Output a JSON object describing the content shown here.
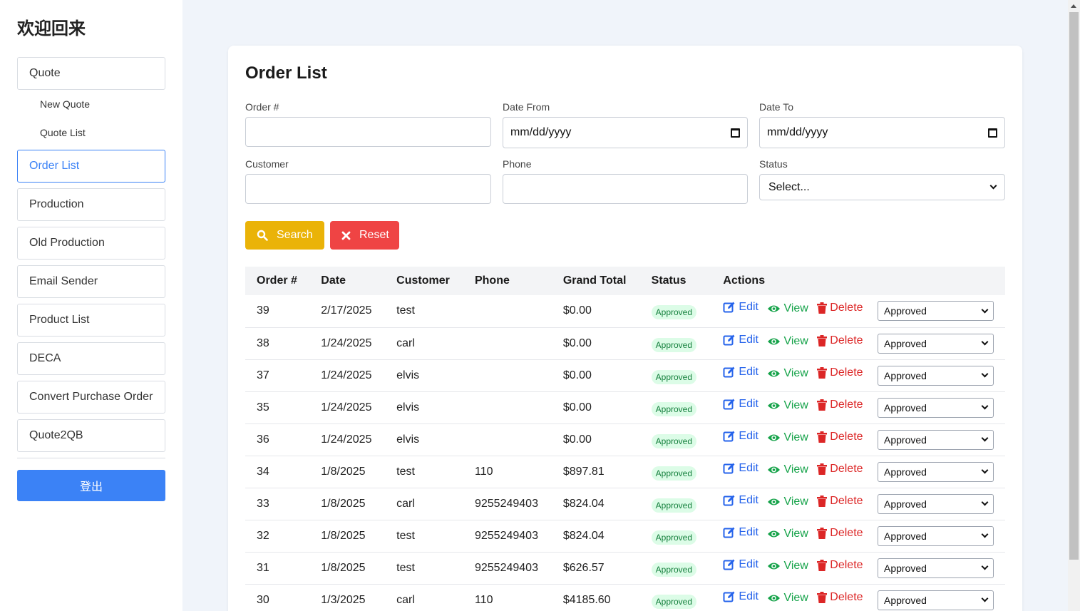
{
  "sidebar": {
    "title": "欢迎回来",
    "quote": "Quote",
    "sub_items": [
      "New Quote",
      "Quote List"
    ],
    "items": [
      "Order List",
      "Production",
      "Old Production",
      "Email Sender",
      "Product List",
      "DECA",
      "Convert Purchase Order",
      "Quote2QB"
    ],
    "active": "Order List",
    "logout": "登出"
  },
  "main": {
    "title": "Order List",
    "filters": {
      "order_label": "Order #",
      "date_from_label": "Date From",
      "date_from_value": "mm/dd/yyyy",
      "date_to_label": "Date To",
      "date_to_value": "mm/dd/yyyy",
      "customer_label": "Customer",
      "phone_label": "Phone",
      "status_label": "Status",
      "status_value": "Select..."
    },
    "search_label": "Search",
    "reset_label": "Reset"
  },
  "table": {
    "headers": [
      "Order #",
      "Date",
      "Customer",
      "Phone",
      "Grand Total",
      "Status",
      "Actions"
    ],
    "actions": {
      "edit": "Edit",
      "view": "View",
      "delete": "Delete"
    },
    "rows": [
      {
        "order": "39",
        "date": "2/17/2025",
        "customer": "test",
        "phone": "",
        "total": "$0.00",
        "status": "Approved",
        "select": "Approved"
      },
      {
        "order": "38",
        "date": "1/24/2025",
        "customer": "carl",
        "phone": "",
        "total": "$0.00",
        "status": "Approved",
        "select": "Approved"
      },
      {
        "order": "37",
        "date": "1/24/2025",
        "customer": "elvis",
        "phone": "",
        "total": "$0.00",
        "status": "Approved",
        "select": "Approved"
      },
      {
        "order": "35",
        "date": "1/24/2025",
        "customer": "elvis",
        "phone": "",
        "total": "$0.00",
        "status": "Approved",
        "select": "Approved"
      },
      {
        "order": "36",
        "date": "1/24/2025",
        "customer": "elvis",
        "phone": "",
        "total": "$0.00",
        "status": "Approved",
        "select": "Approved"
      },
      {
        "order": "34",
        "date": "1/8/2025",
        "customer": "test",
        "phone": "110",
        "total": "$897.81",
        "status": "Approved",
        "select": "Approved"
      },
      {
        "order": "33",
        "date": "1/8/2025",
        "customer": "carl",
        "phone": "9255249403",
        "total": "$824.04",
        "status": "Approved",
        "select": "Approved"
      },
      {
        "order": "32",
        "date": "1/8/2025",
        "customer": "test",
        "phone": "9255249403",
        "total": "$824.04",
        "status": "Approved",
        "select": "Approved"
      },
      {
        "order": "31",
        "date": "1/8/2025",
        "customer": "test",
        "phone": "9255249403",
        "total": "$626.57",
        "status": "Approved",
        "select": "Approved"
      },
      {
        "order": "30",
        "date": "1/3/2025",
        "customer": "carl",
        "phone": "110",
        "total": "$4185.60",
        "status": "Approved",
        "select": "Approved"
      }
    ]
  },
  "colors": {
    "primary": "#3b82f6",
    "search": "#eab308",
    "reset": "#ef4444",
    "edit": "#2563eb",
    "view": "#16a34a",
    "delete": "#dc2626",
    "badge_bg": "#dcfce7",
    "badge_text": "#15803d"
  },
  "icons": {
    "search": "magnifier-icon",
    "reset": "x-icon",
    "edit": "pencil-square-icon",
    "view": "eye-icon",
    "delete": "trash-icon",
    "date": "calendar-icon",
    "select": "chevron-down-icon"
  }
}
